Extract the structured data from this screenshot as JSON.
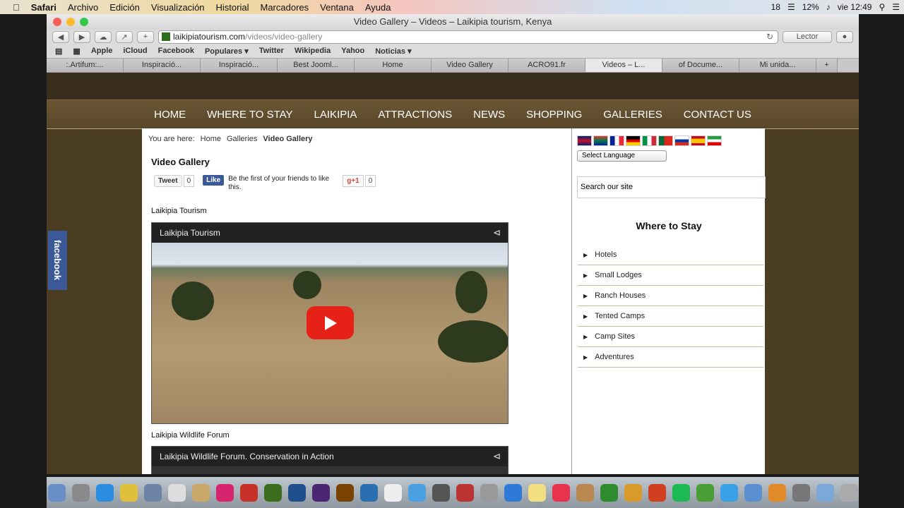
{
  "menubar": {
    "apple": "",
    "app": "Safari",
    "items": [
      "Archivo",
      "Edición",
      "Visualización",
      "Historial",
      "Marcadores",
      "Ventana",
      "Ayuda"
    ],
    "status": {
      "notif": "18",
      "battery": "12%",
      "clock": "vie 12:49"
    }
  },
  "window": {
    "title": "Video Gallery – Videos – Laikipia tourism, Kenya",
    "url_host": "laikipiatourism.com",
    "url_path": "/videos/video-gallery",
    "reader": "Lector",
    "bookmarks": [
      "Apple",
      "iCloud",
      "Facebook",
      "Populares ▾",
      "Twitter",
      "Wikipedia",
      "Yahoo",
      "Noticias ▾"
    ],
    "tabs": [
      ":.Artifum:...",
      "Inspiració...",
      "Inspiració...",
      "Best Jooml...",
      "Home",
      "Video Gallery",
      "ACRO91.fr",
      "Videos – L...",
      "of Docume...",
      "Mi unida..."
    ],
    "active_tab": 7
  },
  "site": {
    "nav": [
      "HOME",
      "WHERE TO STAY",
      "LAIKIPIA",
      "ATTRACTIONS",
      "NEWS",
      "SHOPPING",
      "GALLERIES",
      "CONTACT US"
    ],
    "breadcrumb": {
      "prefix": "You are here:",
      "home": "Home",
      "galleries": "Galleries",
      "current": "Video Gallery"
    },
    "page_title": "Video Gallery",
    "social": {
      "tweet": "Tweet",
      "tweet_count": "0",
      "like": "Like",
      "like_text": "Be the first of your friends to like this.",
      "gplus": "g+1",
      "gplus_count": "0"
    },
    "video1_label": "Laikipia Tourism",
    "video1_title": "Laikipia Tourism",
    "video2_label": "Laikipia Wildlife Forum",
    "video2_title": "Laikipia Wildlife Forum. Conservation in Action",
    "facebook_tab": "facebook"
  },
  "sidebar": {
    "language_select": "Select Language",
    "search_placeholder": "Search our site",
    "where_to_stay_title": "Where to Stay",
    "stay_items": [
      "Hotels",
      "Small Lodges",
      "Ranch Houses",
      "Tented Camps",
      "Camp Sites",
      "Adventures"
    ]
  },
  "colors": {
    "nav_bg": "#5a482a",
    "page_bg": "#4b3d22",
    "youtube_red": "#e62117",
    "facebook_blue": "#3b5998"
  }
}
